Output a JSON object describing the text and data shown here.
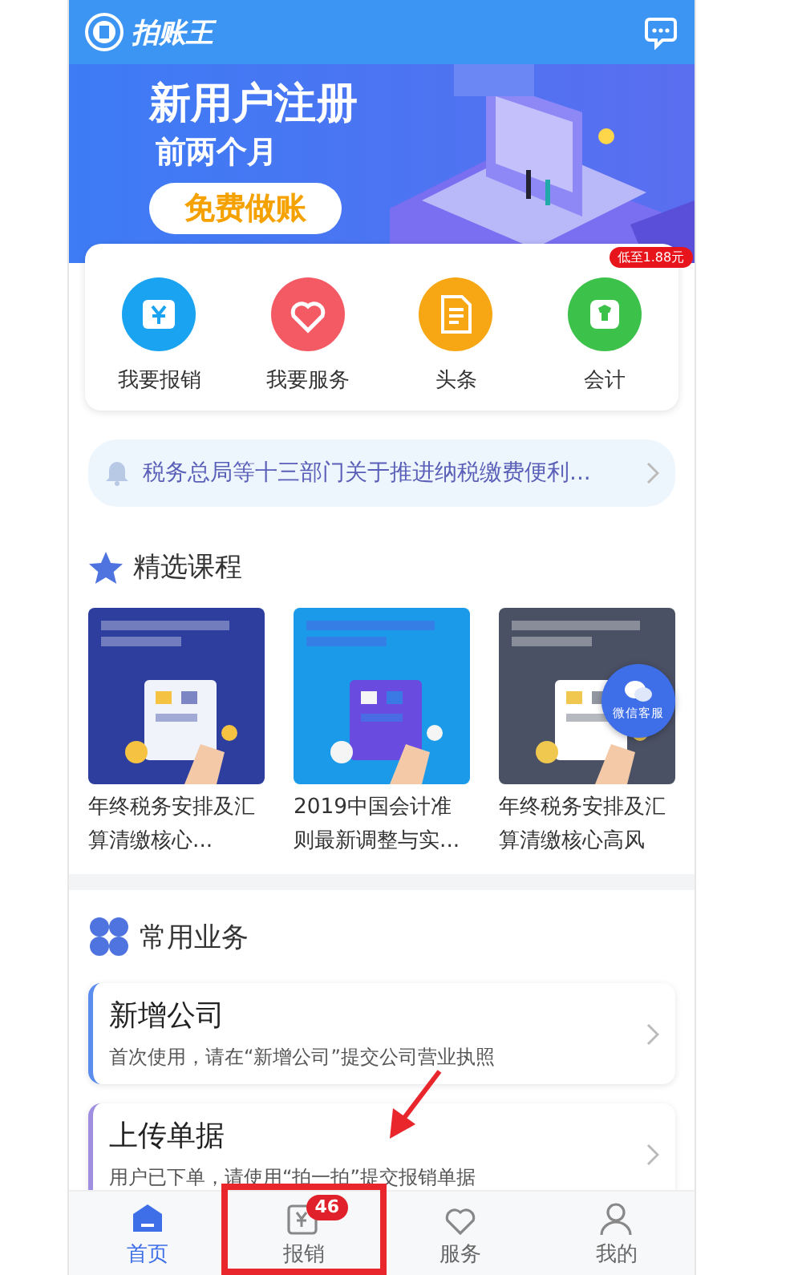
{
  "header": {
    "logo_text": "拍账王"
  },
  "banner": {
    "title": "新用户注册",
    "subtitle": "前两个月",
    "button": "免费做账"
  },
  "shortcuts": [
    {
      "label": "我要报销",
      "kind": "receipt",
      "color": "#1aa3f0"
    },
    {
      "label": "我要服务",
      "kind": "heart",
      "color": "#f45a64"
    },
    {
      "label": "头条",
      "kind": "document",
      "color": "#f7a713"
    },
    {
      "label": "会计",
      "kind": "shirt",
      "color": "#3cc24a",
      "badge": "低至1.88元"
    }
  ],
  "news": {
    "text": "税务总局等十三部门关于推进纳税缴费便利..."
  },
  "courses": {
    "title": "精选课程",
    "items": [
      {
        "title": "年终税务安排及汇算清缴核心...",
        "kind": "navy"
      },
      {
        "title": "2019中国会计准则最新调整与实...",
        "kind": "sky"
      },
      {
        "title": "年终税务安排及汇算清缴核心高风",
        "kind": "slate"
      }
    ],
    "float_button": "微信客服"
  },
  "business": {
    "title": "常用业务",
    "items": [
      {
        "title": "新增公司",
        "desc": "首次使用，请在“新增公司”提交公司营业执照",
        "color": "#5b8def"
      },
      {
        "title": "上传单据",
        "desc": "用户已下单，请使用“拍一拍”提交报销单据",
        "color": "#a08ee0"
      }
    ]
  },
  "tabs": [
    {
      "label": "首页",
      "kind": "home",
      "selected": true
    },
    {
      "label": "报销",
      "kind": "receipt",
      "selected": false,
      "badge": "46"
    },
    {
      "label": "服务",
      "kind": "heart",
      "selected": false
    },
    {
      "label": "我的",
      "kind": "person",
      "selected": false
    }
  ]
}
